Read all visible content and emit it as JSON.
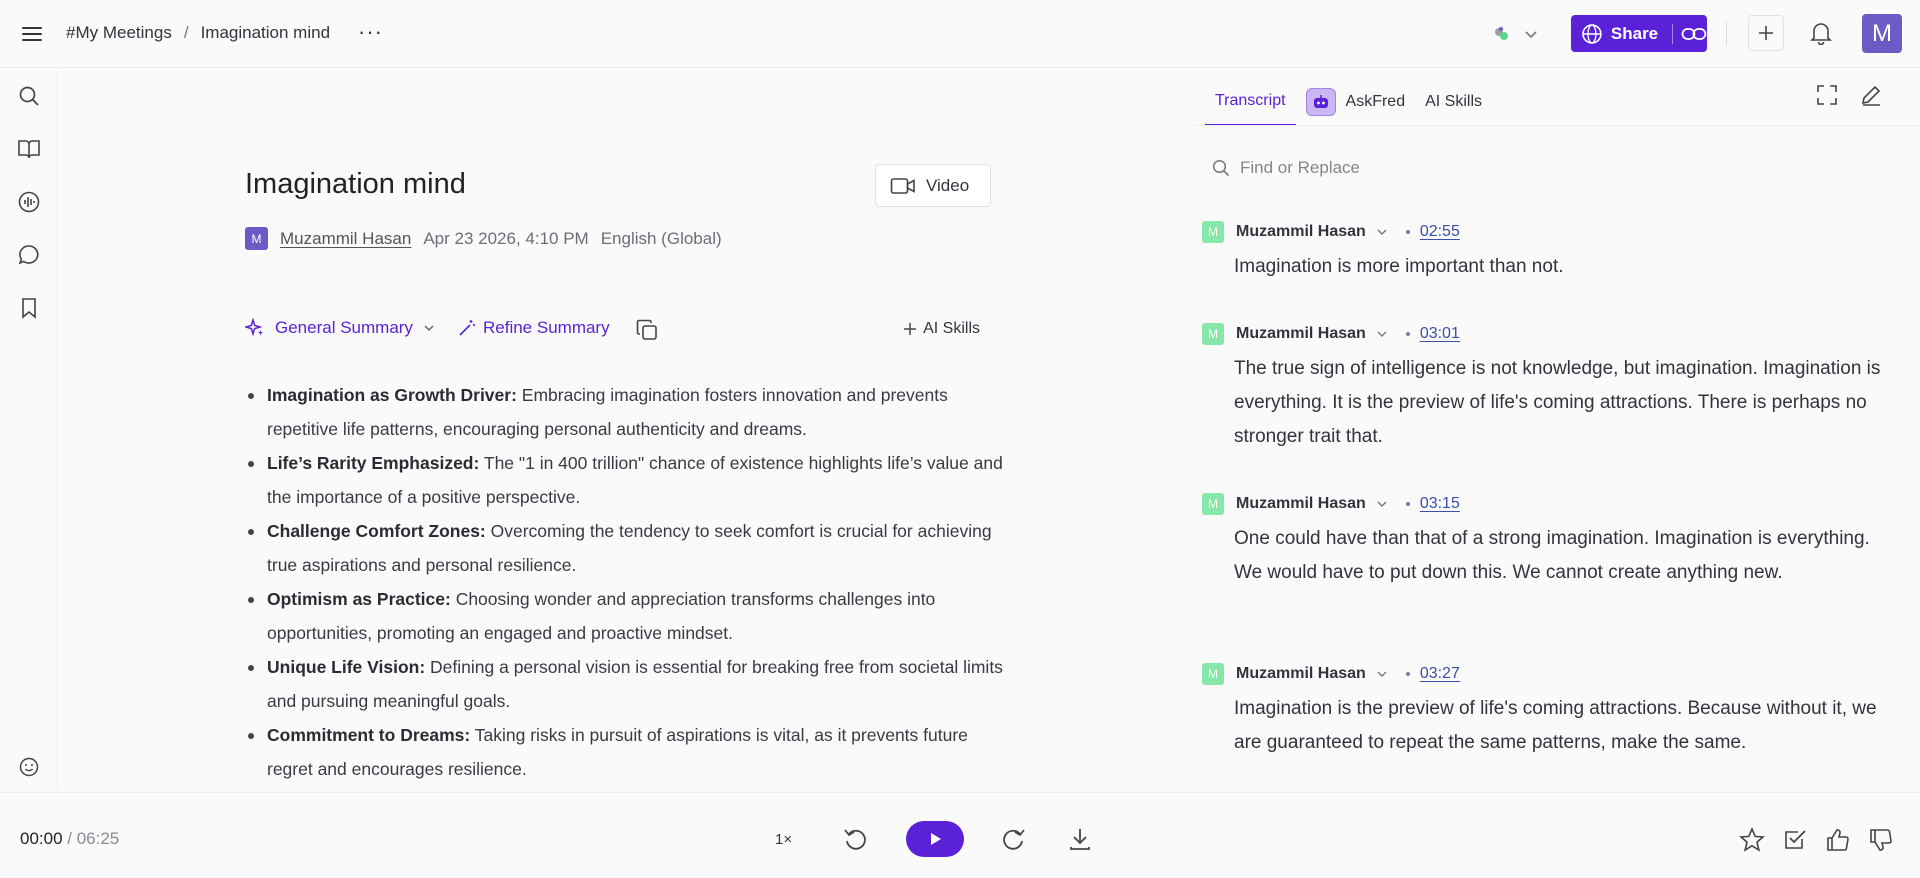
{
  "breadcrumb": {
    "root": "#My Meetings",
    "separator": "/",
    "current": "Imagination mind"
  },
  "header": {
    "share_label": "Share",
    "avatar_letter": "M"
  },
  "meeting": {
    "title": "Imagination mind",
    "video_label": "Video",
    "author_initial": "M",
    "author": "Muzammil Hasan",
    "date": "Apr 23 2026, 4:10 PM",
    "language": "English (Global)"
  },
  "summary_bar": {
    "general": "General Summary",
    "refine": "Refine Summary",
    "ai_skills": "AI Skills"
  },
  "summary": [
    {
      "heading": "Imagination as Growth Driver:",
      "text": " Embracing imagination fosters innovation and prevents repetitive life patterns, encouraging personal authenticity and dreams."
    },
    {
      "heading": "Life’s Rarity Emphasized:",
      "text": " The \"1 in 400 trillion\" chance of existence highlights life’s value and the importance of a positive perspective."
    },
    {
      "heading": "Challenge Comfort Zones:",
      "text": " Overcoming the tendency to seek comfort is crucial for achieving true aspirations and personal resilience."
    },
    {
      "heading": "Optimism as Practice:",
      "text": " Choosing wonder and appreciation transforms challenges into opportunities, promoting an engaged and proactive mindset."
    },
    {
      "heading": "Unique Life Vision:",
      "text": " Defining a personal vision is essential for breaking free from societal limits and pursuing meaningful goals."
    },
    {
      "heading": "Commitment to Dreams:",
      "text": " Taking risks in pursuit of aspirations is vital, as it prevents future regret and encourages resilience."
    }
  ],
  "tabs": {
    "transcript": "Transcript",
    "askfred": "AskFred",
    "ai_skills": "AI Skills"
  },
  "find": {
    "placeholder": "Find or Replace"
  },
  "transcript": [
    {
      "initial": "M",
      "speaker": "Muzammil Hasan",
      "time": "02:55",
      "text": "Imagination is more important than not."
    },
    {
      "initial": "M",
      "speaker": "Muzammil Hasan",
      "time": "03:01",
      "text": "The true sign of intelligence is not knowledge, but imagination. Imagination is everything. It is the preview of life's coming attractions. There is perhaps no stronger trait that."
    },
    {
      "initial": "M",
      "speaker": "Muzammil Hasan",
      "time": "03:15",
      "text": "One could have than that of a strong imagination. Imagination is everything. We would have to put down this. We cannot create anything new."
    },
    {
      "initial": "M",
      "speaker": "Muzammil Hasan",
      "time": "03:27",
      "text": "Imagination is the preview of life's coming attractions. Because without it, we are guaranteed to repeat the same patterns, make the same."
    }
  ],
  "player": {
    "current": "00:00",
    "separator": " / ",
    "total": "06:25",
    "speed": "1×"
  },
  "colors": {
    "accent": "#5b21d9",
    "avatar": "#6a5bc6",
    "speaker_avatar": "#86e7a8",
    "timestamp": "#3b4ea8"
  }
}
